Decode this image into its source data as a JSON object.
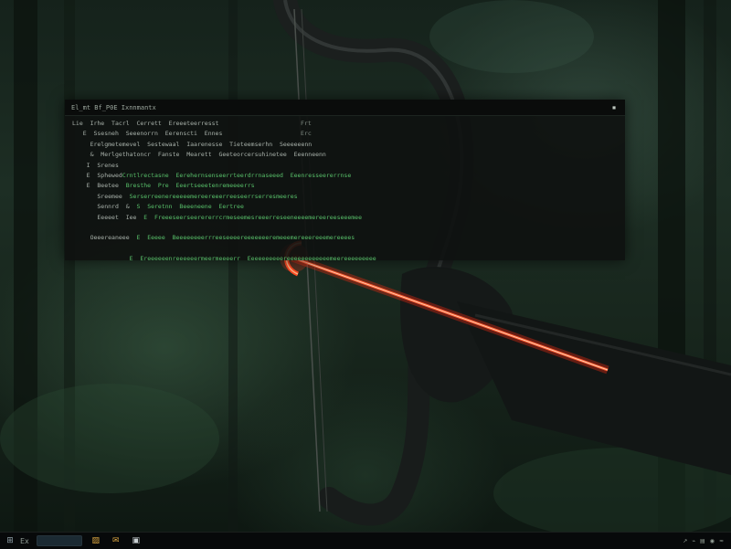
{
  "terminal": {
    "title": "El_mt  Bf_P0E  Ixnnmantx",
    "close_glyph": "▪",
    "lines": [
      {
        "grey": "Lie  Irhe  Tacrl  Cerrett  Ereeeteerresst",
        "green": "",
        "right": "Frt"
      },
      {
        "grey": "   E  Ssesneh  Seeenorrn  Eerenscti  Ennes",
        "green": "",
        "right": "Erc"
      },
      {
        "grey": "     Erelgmetemevel  Sestewaal  Iaarenesse  Tieteemserhn  Seeeeeenn",
        "green": "",
        "right": ""
      },
      {
        "grey": "     &  Merlgethatoncr  Fanste  Mearett  Geeteorcersuhinetee  Eeenneenn",
        "green": "",
        "right": ""
      },
      {
        "grey": "    I  Srenes",
        "green": "",
        "right": ""
      },
      {
        "grey": "    E  Sphewed",
        "green": "Crntlrectasne  Eerehernsenseerrteerdrrnaseeed  Eeenresseererrnse",
        "right": ""
      },
      {
        "grey": "    E  Beetee",
        "green": "  Bresthe  Pre  Eeertseeetenremeeeerrs",
        "right": ""
      },
      {
        "grey": "       Sreemee",
        "green": "  Serserreenereeeeemereereeerreeseerrserresmeeres",
        "right": ""
      },
      {
        "grey": "       Sennrd  &",
        "green": "  S  Seretnn  Beeeneene  Eertree",
        "right": ""
      },
      {
        "grey": "       Eeeeet  Iee",
        "green": "  E  Freeeseerseerererrcrmeseemesreeerreseeneeeemereereeseeemee",
        "right": ""
      },
      {
        "grey": "                  ",
        "green": "",
        "right": ""
      },
      {
        "grey": "     Oeeereaneee",
        "green": "  E  Eeeee  Beeeeeeeerrreeseeeereeeeeeeremeeemereeereeemereeees",
        "right": ""
      },
      {
        "grey": "                  ",
        "green": "",
        "right": ""
      },
      {
        "grey": "                ",
        "green": "E  Ereeeeeenreeeeeermeermeeeerr  Eeeeeeeeeereeeeeeeeeeeemeereeeeeeeee",
        "right": ""
      }
    ]
  },
  "taskbar": {
    "start_glyph": "⊞",
    "pinned_label": "Ex",
    "search_label": "",
    "icons": [
      {
        "name": "folder-icon",
        "glyph": "▨",
        "color": "#d9a441"
      },
      {
        "name": "mail-icon",
        "glyph": "✉",
        "color": "#d9a441"
      },
      {
        "name": "store-icon",
        "glyph": "▣",
        "color": "#c9cfd2"
      }
    ],
    "tray": [
      "↗",
      "⌁",
      "▤",
      "◉",
      "≈"
    ]
  },
  "colors": {
    "terminal_bg": "#0e110f",
    "terminal_text": "#a8b1aa",
    "terminal_green": "#58c06a",
    "taskbar_bg": "#07090a",
    "laser": "#ff3b1f"
  }
}
